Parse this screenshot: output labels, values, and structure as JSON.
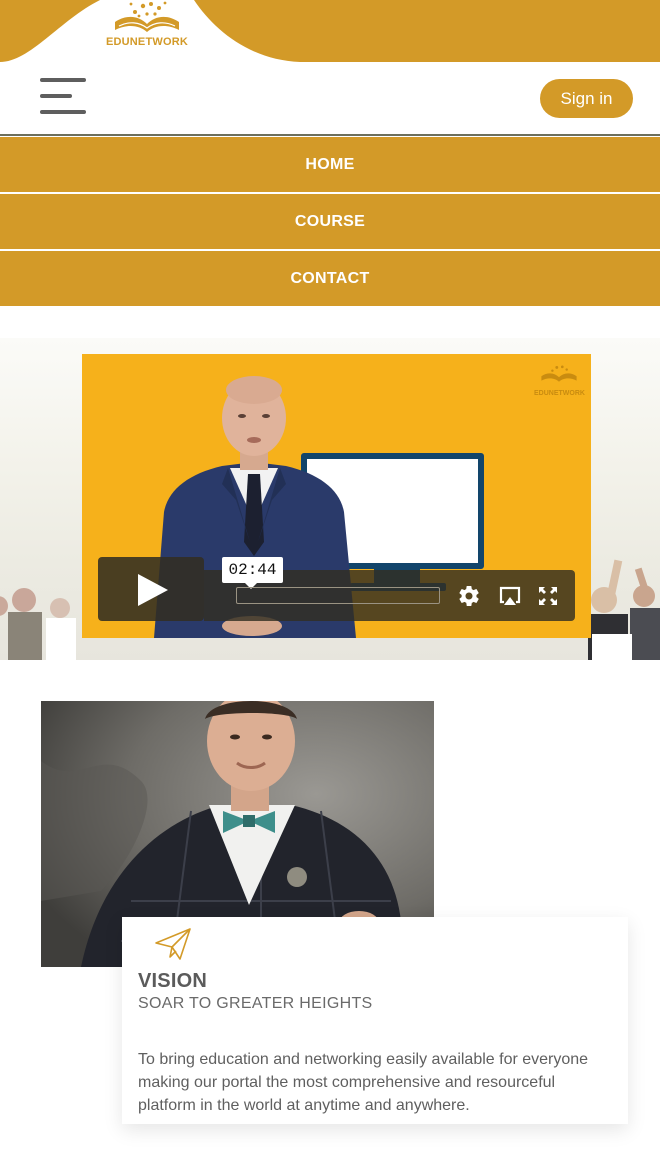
{
  "brand": {
    "name": "EDUNETWORK",
    "accent_color": "#d39a28"
  },
  "header": {
    "menu_icon": "hamburger-menu-icon",
    "signin_label": "Sign in"
  },
  "nav": {
    "items": [
      {
        "label": "HOME"
      },
      {
        "label": "COURSE"
      },
      {
        "label": "CONTACT"
      }
    ]
  },
  "video": {
    "brand_label": "EDUNETWORK",
    "time_tooltip": "02:44",
    "progress": 0,
    "controls": [
      "play-icon",
      "settings-gear-icon",
      "airplay-icon",
      "fullscreen-icon"
    ],
    "background_color": "#f6b11b"
  },
  "vision": {
    "icon": "paper-plane-icon",
    "title": "VISION",
    "subtitle": "SOAR TO GREATER HEIGHTS",
    "body": "To bring education and networking easily available for everyone making our portal the most comprehensive and resourceful platform in the world at anytime and anywhere."
  }
}
